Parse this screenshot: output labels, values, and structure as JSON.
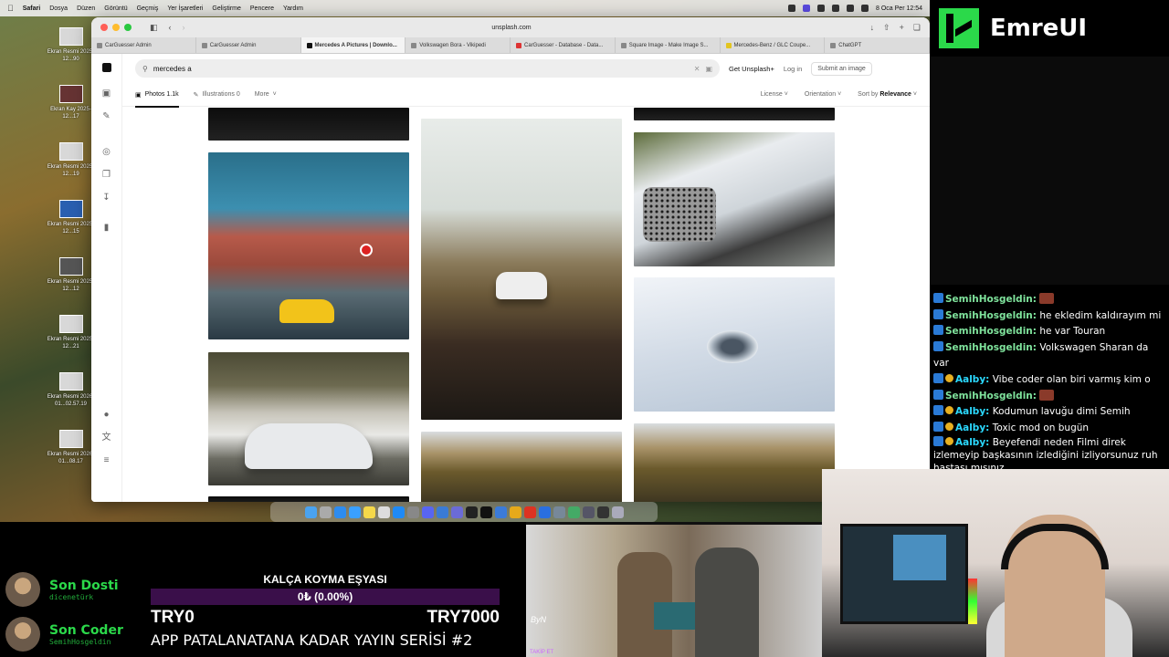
{
  "menubar": {
    "app": "Safari",
    "items": [
      "Dosya",
      "Düzen",
      "Görüntü",
      "Geçmiş",
      "Yer İşaretleri",
      "Geliştirme",
      "Pencere",
      "Yardım"
    ],
    "clock": "8 Oca Per 12:54"
  },
  "desktop": {
    "items": [
      {
        "label": "Ekran Resmi 2025-12...90"
      },
      {
        "label": "Ekran Kay 2025-12...17"
      },
      {
        "label": "Ekran Resmi 2025-12...19"
      },
      {
        "label": "Ekran Resmi 2025-12...15"
      },
      {
        "label": "Ekran Resmi 2025-12...12"
      },
      {
        "label": "Ekran Resmi 2025-12...21"
      },
      {
        "label": "Ekran Resmi 2026-01...02.57.19"
      },
      {
        "label": "Ekran Resmi 2026-01...08.17"
      }
    ]
  },
  "browser": {
    "address": "unsplash.com",
    "tabs": [
      {
        "label": "CarGuesser Admin",
        "active": false
      },
      {
        "label": "CarGuesser Admin",
        "active": false
      },
      {
        "label": "Mercedes A Pictures | Downlo...",
        "active": true
      },
      {
        "label": "Volkswagen Bora - Vikipedi",
        "active": false
      },
      {
        "label": "CarGuesser - Database - Data...",
        "active": false
      },
      {
        "label": "Square Image - Make Image S...",
        "active": false
      },
      {
        "label": "Mercedes-Benz / GLC Coupe...",
        "active": false
      },
      {
        "label": "ChatGPT",
        "active": false
      }
    ]
  },
  "unsplash": {
    "search_value": "mercedes a",
    "get_plus": "Get Unsplash+",
    "login": "Log in",
    "submit": "Submit an image",
    "tabs": [
      {
        "label": "Photos 1.1k"
      },
      {
        "label": "Illustrations 0"
      },
      {
        "label": "More"
      }
    ],
    "filters": {
      "license": "License",
      "orientation": "Orientation",
      "sort_prefix": "Sort by",
      "sort_value": "Relevance"
    }
  },
  "branding": {
    "name": "EmreUI"
  },
  "chat": {
    "top_cut": "",
    "messages": [
      {
        "user": "SemihHosgeldin:",
        "text": "",
        "badges": 1,
        "nick_style": "a",
        "emote": true
      },
      {
        "user": "SemihHosgeldin:",
        "text": "he ekledim kaldırayım mi",
        "badges": 1,
        "nick_style": "a",
        "emote": false
      },
      {
        "user": "SemihHosgeldin:",
        "text": "he var Touran",
        "badges": 1,
        "nick_style": "a",
        "emote": false
      },
      {
        "user": "SemihHosgeldin:",
        "text": "Volkswagen Sharan da var",
        "badges": 1,
        "nick_style": "a",
        "emote": false
      },
      {
        "user": "Aalby:",
        "text": "Vibe coder olan biri varmış kim o",
        "badges": 2,
        "nick_style": "b",
        "emote": false
      },
      {
        "user": "SemihHosgeldin:",
        "text": "",
        "badges": 1,
        "nick_style": "a",
        "emote": true
      },
      {
        "user": "Aalby:",
        "text": "Kodumun lavuğu dimi Semih",
        "badges": 2,
        "nick_style": "b",
        "emote": false
      },
      {
        "user": "Aalby:",
        "text": "Toxic mod on bugün",
        "badges": 2,
        "nick_style": "b",
        "emote": false
      },
      {
        "user": "Aalby:",
        "text": "Beyefendi neden Filmi direk izlemeyip başkasının izlediğini izliyorsunuz ruh hastası mısınız",
        "badges": 2,
        "nick_style": "b",
        "emote": false
      }
    ]
  },
  "supporters": [
    {
      "role": "Son Dosti",
      "name": "dicenetürk"
    },
    {
      "role": "Son Coder",
      "name": "SemihHosgeldin"
    }
  ],
  "goal": {
    "title": "KALÇA KOYMA EŞYASI",
    "progress_label": "0₺ (0.00%)",
    "progress_fraction": 0.0,
    "min": "TRY0",
    "max": "TRY7000",
    "series": "APP PATALANATANA KADAR YAYIN SERİSİ #2"
  },
  "video": {
    "signature": "ByN",
    "tag": "TAKİP ET"
  },
  "colors": {
    "accent_green": "#2bd94a",
    "goal_purple": "#a020c0"
  }
}
